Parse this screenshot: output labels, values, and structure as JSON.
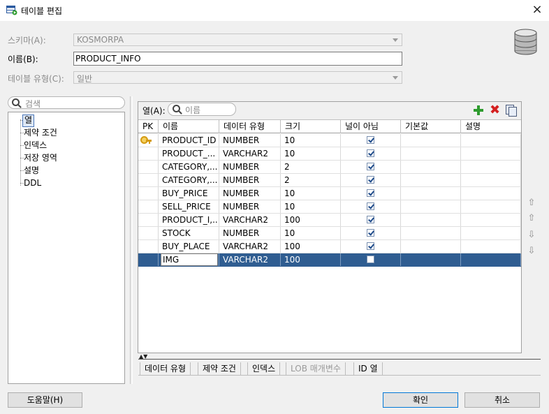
{
  "window": {
    "title": "테이블 편집",
    "close_glyph": "×"
  },
  "form": {
    "schema_label": "스키마(A):",
    "schema_value": "KOSMORPA",
    "name_label": "이름(B):",
    "name_value": "PRODUCT_INFO",
    "table_type_label": "테이블 유형(C):",
    "table_type_value": "일반"
  },
  "tree": {
    "search_placeholder": "검색",
    "items": [
      "열",
      "제약 조건",
      "인덱스",
      "저장 영역",
      "설명",
      "DDL"
    ],
    "selected_index": 0
  },
  "columns_panel": {
    "label": "열(A):",
    "search_placeholder": "이름",
    "headers": [
      "PK",
      "이름",
      "데이터 유형",
      "크기",
      "널이 아님",
      "기본값",
      "설명"
    ],
    "rows": [
      {
        "pk": true,
        "name": "PRODUCT_ID",
        "type": "NUMBER",
        "size": "10",
        "not_null": true,
        "default": "",
        "desc": ""
      },
      {
        "pk": false,
        "name": "PRODUCT_...",
        "type": "VARCHAR2",
        "size": "10",
        "not_null": true,
        "default": "",
        "desc": ""
      },
      {
        "pk": false,
        "name": "CATEGORY,...",
        "type": "NUMBER",
        "size": "2",
        "not_null": true,
        "default": "",
        "desc": ""
      },
      {
        "pk": false,
        "name": "CATEGORY,...",
        "type": "NUMBER",
        "size": "2",
        "not_null": true,
        "default": "",
        "desc": ""
      },
      {
        "pk": false,
        "name": "BUY_PRICE",
        "type": "NUMBER",
        "size": "10",
        "not_null": true,
        "default": "",
        "desc": ""
      },
      {
        "pk": false,
        "name": "SELL_PRICE",
        "type": "NUMBER",
        "size": "10",
        "not_null": true,
        "default": "",
        "desc": ""
      },
      {
        "pk": false,
        "name": "PRODUCT_I,...",
        "type": "VARCHAR2",
        "size": "100",
        "not_null": true,
        "default": "",
        "desc": ""
      },
      {
        "pk": false,
        "name": "STOCK",
        "type": "NUMBER",
        "size": "10",
        "not_null": true,
        "default": "",
        "desc": ""
      },
      {
        "pk": false,
        "name": "BUY_PLACE",
        "type": "VARCHAR2",
        "size": "100",
        "not_null": true,
        "default": "",
        "desc": ""
      },
      {
        "pk": false,
        "name": "IMG",
        "type": "VARCHAR2",
        "size": "100",
        "not_null": false,
        "default": "",
        "desc": "",
        "selected": true,
        "editing": true
      }
    ]
  },
  "bottom_tabs": [
    "데이터 유형",
    "제약 조건",
    "인덱스",
    "LOB 매개변수",
    "ID 열"
  ],
  "bottom_tabs_disabled": [
    3
  ],
  "buttons": {
    "help": "도움말(H)",
    "ok": "확인",
    "cancel": "취소"
  },
  "icons": {
    "app": "table-edit-icon",
    "db": "database-icon",
    "search": "search-icon",
    "add": "plus-icon",
    "delete": "delete-icon",
    "copy": "copy-icon",
    "key": "key-icon",
    "move_top": "move-top-icon",
    "move_up": "move-up-icon",
    "move_down": "move-down-icon",
    "move_bottom": "move-bottom-icon"
  },
  "colors": {
    "selection": "#2f5d91",
    "add": "#2e9b2e",
    "delete": "#d42020",
    "key": "#d49a10"
  }
}
